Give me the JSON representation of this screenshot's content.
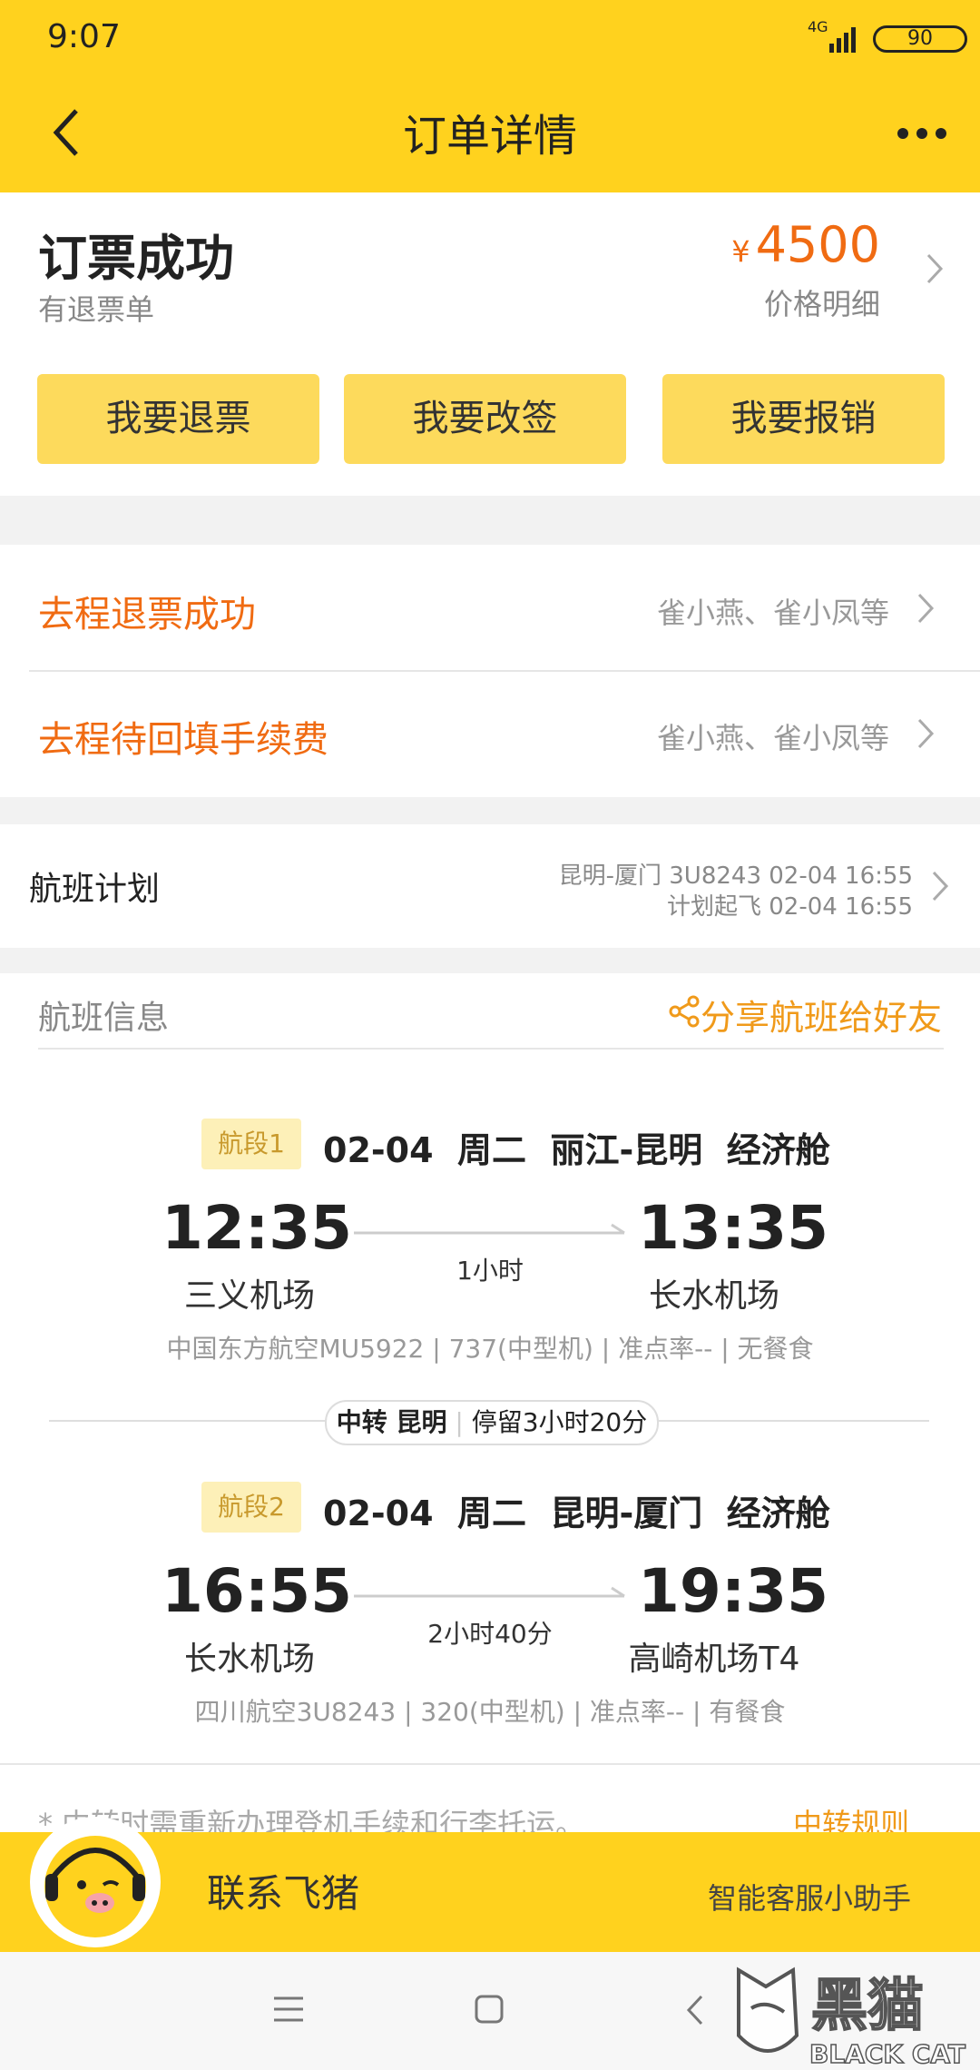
{
  "status_bar": {
    "time": "9:07",
    "network": "4G",
    "battery": "90"
  },
  "header": {
    "title": "订单详情"
  },
  "summary": {
    "status": "订票成功",
    "note": "有退票单",
    "currency": "¥",
    "price": "4500",
    "price_detail": "价格明细"
  },
  "actions": [
    {
      "label": "我要退票"
    },
    {
      "label": "我要改签"
    },
    {
      "label": "我要报销"
    }
  ],
  "notices": [
    {
      "title": "去程退票成功",
      "names": "雀小燕、雀小凤等"
    },
    {
      "title": "去程待回填手续费",
      "names": "雀小燕、雀小凤等"
    }
  ],
  "flight_plan": {
    "label": "航班计划",
    "line1": "昆明-厦门 3U8243 02-04 16:55",
    "line2": "计划起飞 02-04 16:55"
  },
  "flight_info": {
    "title": "航班信息",
    "share": "分享航班给好友"
  },
  "segments": [
    {
      "badge": "航段1",
      "date": "02-04",
      "weekday": "周二",
      "route": "丽江-昆明",
      "cabin": "经济舱",
      "dep_time": "12:35",
      "arr_time": "13:35",
      "duration": "1小时",
      "dep_airport": "三义机场",
      "arr_airport": "长水机场",
      "meta": "中国东方航空MU5922 | 737(中型机) | 准点率-- | 无餐食"
    },
    {
      "badge": "航段2",
      "date": "02-04",
      "weekday": "周二",
      "route": "昆明-厦门",
      "cabin": "经济舱",
      "dep_time": "16:55",
      "arr_time": "19:35",
      "duration": "2小时40分",
      "dep_airport": "长水机场",
      "arr_airport": "高崎机场T4",
      "meta": "四川航空3U8243 | 320(中型机) | 准点率-- | 有餐食"
    }
  ],
  "transfer": {
    "label": "中转 昆明",
    "stay": "停留3小时20分"
  },
  "footer_note": {
    "text": "* 中转时需重新办理登机手续和行李托运。",
    "link": "中转规则"
  },
  "contact_bar": {
    "contact": "联系飞猪",
    "assistant": "智能客服小助手"
  },
  "watermark": {
    "brand_cn": "黑猫",
    "brand_en": "BLACK CAT"
  },
  "colors": {
    "header": "#ffd21e",
    "accent": "#f06b12",
    "button": "#fdda5c",
    "share": "#f09a1a"
  }
}
